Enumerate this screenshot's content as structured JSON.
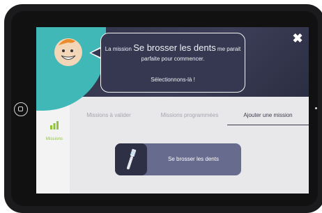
{
  "header": {
    "close_glyph": "✖"
  },
  "bubble": {
    "line1_prefix": "La mission ",
    "mission_name": "Se brosser les dents",
    "line1_suffix": " me parait",
    "line2": "parfaite pour commencer.",
    "line3": "Sélectionnons-là !"
  },
  "sidebar": {
    "missions_label": "Missions",
    "missions_icon": "bar-chart-icon"
  },
  "tabs": [
    {
      "label": "Missions à valider",
      "active": false
    },
    {
      "label": "Missions programmées",
      "active": false
    },
    {
      "label": "Ajouter une mission",
      "active": true
    }
  ],
  "mission_card": {
    "label": "Se brosser les dents",
    "icon": "toothbrush-icon"
  },
  "colors": {
    "teal": "#3fb8b7",
    "navy": "#363852",
    "card": "#676b8e",
    "green": "#8fc33a"
  }
}
